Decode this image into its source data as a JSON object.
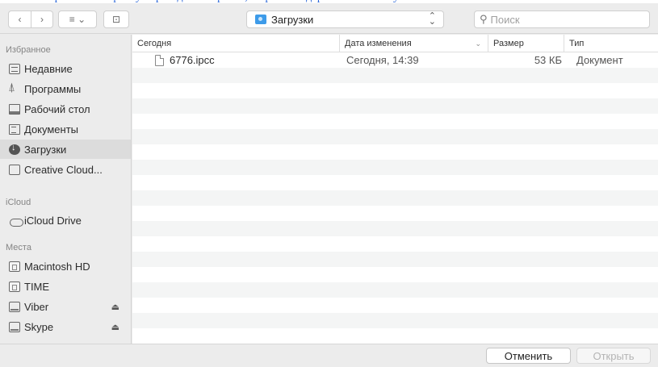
{
  "toolbar": {
    "location": "Загрузки",
    "search_placeholder": "Поиск"
  },
  "sidebar": {
    "sections": [
      {
        "title": "Избранное",
        "items": [
          {
            "label": "Недавние",
            "icon": "recents-icon"
          },
          {
            "label": "Программы",
            "icon": "applications-icon"
          },
          {
            "label": "Рабочий стол",
            "icon": "desktop-icon"
          },
          {
            "label": "Документы",
            "icon": "documents-icon"
          },
          {
            "label": "Загрузки",
            "icon": "downloads-icon",
            "selected": true
          },
          {
            "label": "Creative Cloud...",
            "icon": "folder-icon"
          }
        ]
      },
      {
        "title": "iCloud",
        "items": [
          {
            "label": "iCloud Drive",
            "icon": "cloud-icon"
          }
        ]
      },
      {
        "title": "Места",
        "items": [
          {
            "label": "Macintosh HD",
            "icon": "hard-disk-icon"
          },
          {
            "label": "TIME",
            "icon": "hard-disk-icon"
          },
          {
            "label": "Viber",
            "icon": "external-disk-icon",
            "eject": true
          },
          {
            "label": "Skype",
            "icon": "external-disk-icon",
            "eject": true
          }
        ]
      }
    ]
  },
  "file_list": {
    "columns": {
      "name": "Сегодня",
      "date": "Дата изменения",
      "size": "Размер",
      "kind": "Тип"
    },
    "rows": [
      {
        "name": "6776.ipcc",
        "date": "Сегодня, 14:39",
        "size": "53 КБ",
        "kind": "Документ"
      }
    ]
  },
  "buttons": {
    "cancel": "Отменить",
    "open": "Открыть"
  }
}
